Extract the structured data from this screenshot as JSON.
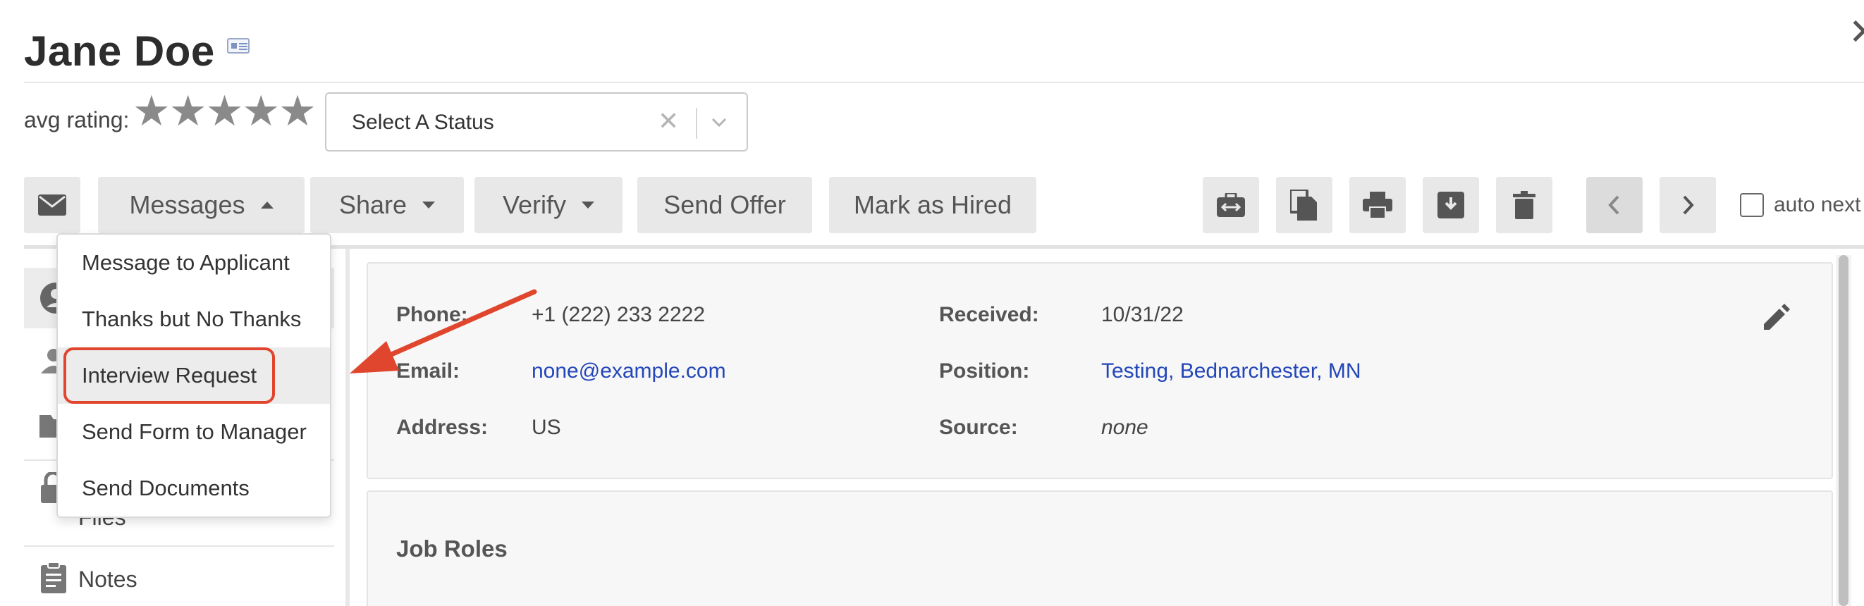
{
  "header": {
    "name": "Jane Doe",
    "rating_label": "avg rating:",
    "stars": "★★★★★",
    "close_glyph": "✕"
  },
  "status_select": {
    "value": "Select A Status",
    "clear_glyph": "✕",
    "chevron_glyph": "⌄"
  },
  "toolbar": {
    "messages_label": "Messages",
    "share_label": "Share",
    "verify_label": "Verify",
    "send_offer_label": "Send Offer",
    "mark_hired_label": "Mark as Hired",
    "auto_next_label": "auto next",
    "icons": [
      "envelope-icon",
      "transfer-icon",
      "copy-icon",
      "print-icon",
      "archive-icon",
      "trash-icon",
      "chevron-left-icon",
      "chevron-right-icon"
    ]
  },
  "messages_menu": {
    "items": [
      "Message to Applicant",
      "Thanks but No Thanks",
      "Interview Request",
      "Send Form to Manager",
      "Send Documents"
    ],
    "highlighted": "Interview Request"
  },
  "sidebar": {
    "items": [
      {
        "label": "",
        "icon": "profile-icon"
      },
      {
        "label": "",
        "icon": "user-icon"
      },
      {
        "label": "",
        "icon": "folder-icon"
      },
      {
        "label": "Files",
        "icon": "lock-icon"
      },
      {
        "label": "Notes",
        "icon": "clipboard-icon"
      }
    ]
  },
  "details": {
    "phone_label": "Phone:",
    "phone_value": "+1 (222) 233 2222",
    "email_label": "Email:",
    "email_value": "none@example.com",
    "address_label": "Address:",
    "address_value": "US",
    "received_label": "Received:",
    "received_value": "10/31/22",
    "position_label": "Position:",
    "position_value": "Testing, Bednarchester, MN",
    "source_label": "Source:",
    "source_value": "none"
  },
  "job_roles": {
    "title": "Job Roles"
  },
  "colors": {
    "annotation": "#e0462d",
    "link": "#2346b8",
    "button_bg": "#e8e8e8"
  }
}
